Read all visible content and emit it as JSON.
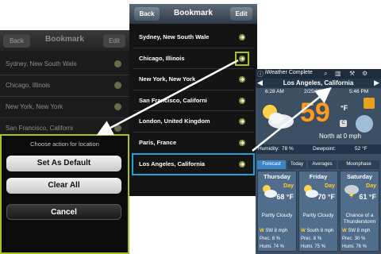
{
  "colors": {
    "highlight_green": "#a6c21e",
    "highlight_blue": "#1ea0d6",
    "temp_orange": "#ff9a1e"
  },
  "left_screen": {
    "back_label": "Back",
    "title": "Bookmark",
    "edit_label": "Edit",
    "items": [
      "Sydney, New South Wale",
      "Chicago, Illinois",
      "New York, New York",
      "San Francisco, Californi"
    ],
    "action_sheet": {
      "prompt": "Choose action for location",
      "set_default_label": "Set As Default",
      "clear_all_label": "Clear All",
      "cancel_label": "Cancel"
    }
  },
  "bookmark_screen": {
    "back_label": "Back",
    "title": "Bookmark",
    "edit_label": "Edit",
    "items": [
      "Sydney, New South Wale",
      "Chicago, Illinois",
      "New York, New York",
      "San Francisco, Californi",
      "London, United Kingdom",
      "Paris, France",
      "Los Angeles, California"
    ],
    "item_icon": "gear-arrow-icon"
  },
  "weather_screen": {
    "app_name": "iWeather Complete",
    "city": "Los Angeles, California",
    "sunrise": "6:28 AM",
    "date": "2/25/20",
    "sunset": "5:46 PM",
    "temperature": "59",
    "unit": "°F",
    "unit_button": "C",
    "wind": "North at 0 mph",
    "humidity_label": "Humidity:",
    "humidity": "78 %",
    "dewpoint_label": "Dewpoint:",
    "dewpoint": "52 °F",
    "tabs": [
      "Forecast",
      "Today",
      "Averages",
      "Moonphase"
    ],
    "active_tab": "Forecast",
    "forecast": [
      {
        "day": "Thursday",
        "label": "Day",
        "temp": "68 °F",
        "condition": "Partly Cloudy",
        "wind": "SW 8 mph",
        "prec": "8 %",
        "humi": "74 %"
      },
      {
        "day": "Friday",
        "label": "Day",
        "temp": "70 °F",
        "condition": "Partly Cloudy",
        "wind": "South 8 mph",
        "prec": "8 %",
        "humi": "75 %"
      },
      {
        "day": "Saturday",
        "label": "Day",
        "temp": "61 °F",
        "condition": "Chance of a Thunderstorm",
        "wind": "SW 8 mph",
        "prec": "30 %",
        "humi": "76 %"
      }
    ],
    "wind_prefix": "W",
    "prec_label": "Prec.",
    "humi_label": "Humi."
  }
}
